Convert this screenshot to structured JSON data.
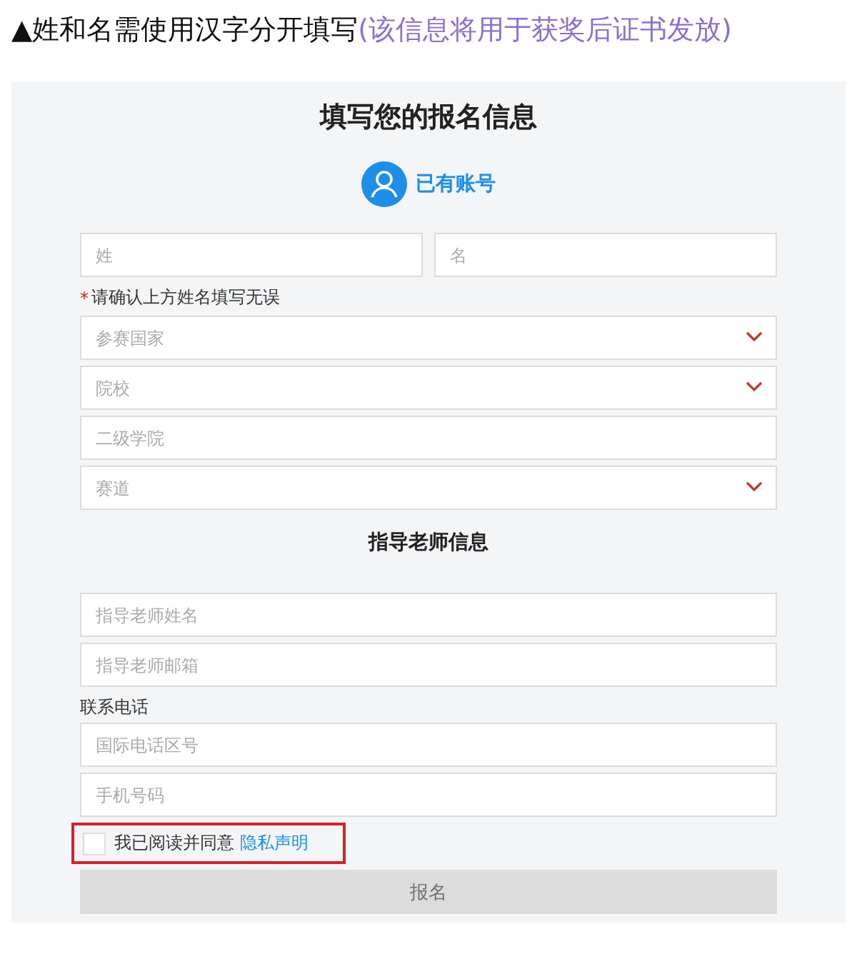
{
  "note": {
    "text": "▲姓和名需使用汉字分开填写",
    "aside": "(该信息将用于获奖后证书发放)"
  },
  "form": {
    "title": "填写您的报名信息",
    "account_link": "已有账号",
    "name_fields": [
      {
        "placeholder": "姓"
      },
      {
        "placeholder": "名"
      }
    ],
    "name_hint": {
      "mark": "*",
      "text": "请确认上方姓名填写无误"
    },
    "fields": [
      {
        "kind": "select",
        "placeholder": "参赛国家"
      },
      {
        "kind": "select",
        "placeholder": "院校"
      },
      {
        "kind": "text",
        "placeholder": "二级学院"
      },
      {
        "kind": "select",
        "placeholder": "赛道"
      }
    ],
    "teacher_heading": "指导老师信息",
    "teacher_fields": [
      {
        "placeholder": "指导老师姓名"
      },
      {
        "placeholder": "指导老师邮箱"
      }
    ],
    "phone_label": "联系电话",
    "phone_fields": [
      {
        "placeholder": "国际电话区号"
      },
      {
        "placeholder": "手机号码"
      }
    ],
    "agreement": {
      "checked": false,
      "text": "我已阅读并同意",
      "link": "隐私声明",
      "highlighted": true
    },
    "submit": {
      "label": "报名",
      "disabled": true
    }
  }
}
